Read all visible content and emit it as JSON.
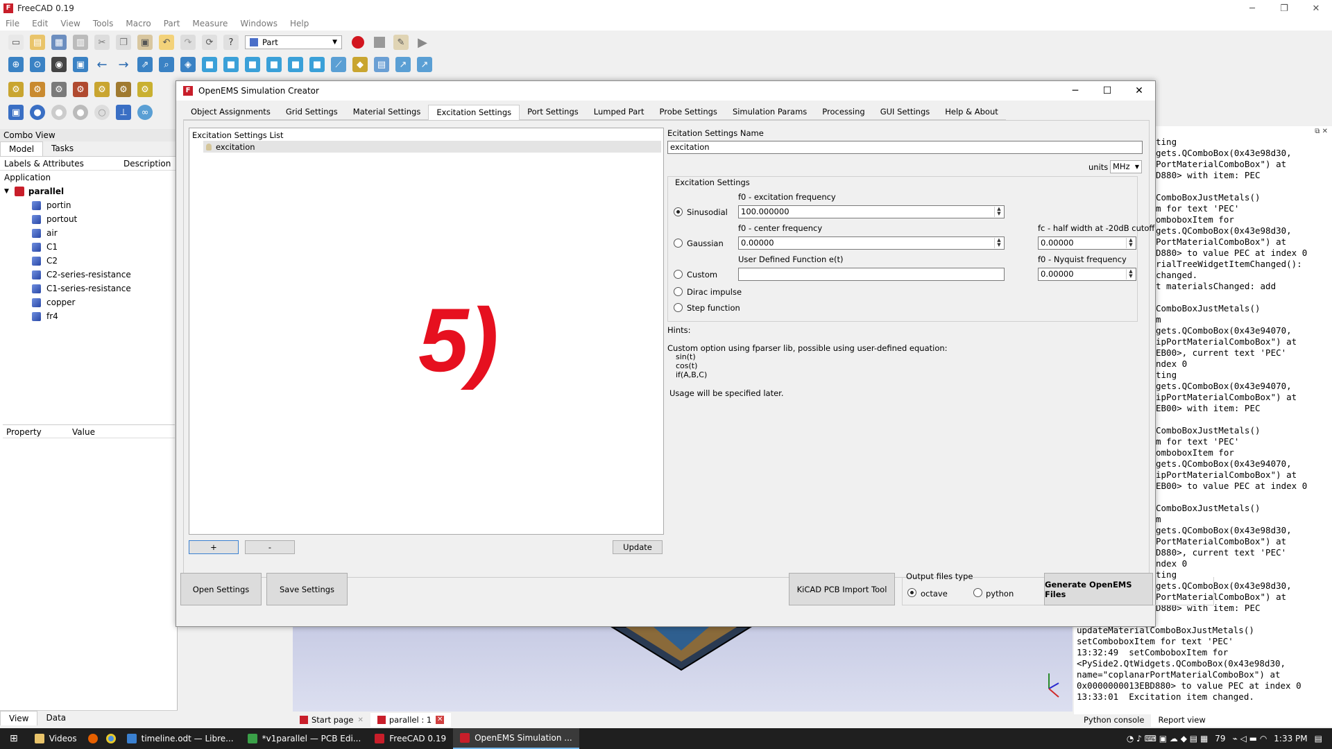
{
  "freecad": {
    "title": "FreeCAD 0.19",
    "menu": [
      "File",
      "Edit",
      "View",
      "Tools",
      "Macro",
      "Part",
      "Measure",
      "Windows",
      "Help"
    ],
    "workbench": "Part"
  },
  "combo_view": {
    "title": "Combo View",
    "tabs": [
      "Model",
      "Tasks"
    ],
    "tree_header": [
      "Labels & Attributes",
      "Description"
    ],
    "application_label": "Application",
    "root": "parallel",
    "items": [
      "portin",
      "portout",
      "air",
      "C1",
      "C2",
      "C2-series-resistance",
      "C1-series-resistance",
      "copper",
      "fr4"
    ],
    "property_header": [
      "Property",
      "Value"
    ],
    "bottom_tabs": [
      "View",
      "Data"
    ]
  },
  "dialog": {
    "title": "OpenEMS Simulation Creator",
    "tabs": [
      "Object Assignments",
      "Grid Settings",
      "Material Settings",
      "Excitation Settings",
      "Port Settings",
      "Lumped Part",
      "Probe Settings",
      "Simulation Params",
      "Processing",
      "GUI Settings",
      "Help & About"
    ],
    "active_tab": "Excitation Settings",
    "list_label": "Excitation Settings List",
    "list_items": [
      "excitation"
    ],
    "overlay_number": "5)",
    "add_label": "+",
    "remove_label": "-",
    "update_label": "Update",
    "name_label": "Ecitation Settings Name",
    "name_value": "excitation",
    "units_label": "units",
    "units_value": "MHz",
    "group_label": "Excitation Settings",
    "sinusoidal": {
      "label": "Sinusodial",
      "freq_label": "f0 - excitation frequency",
      "freq_value": "100.000000"
    },
    "gaussian": {
      "label": "Gaussian",
      "center_label": "f0 - center frequency",
      "center_value": "0.00000",
      "halfwidth_label": "fc - half width at -20dB cutoff",
      "halfwidth_value": "0.00000"
    },
    "custom": {
      "label": "Custom",
      "func_label": "User Defined Function e(t)",
      "func_value": "",
      "nyquist_label": "f0 - Nyquist frequency",
      "nyquist_value": "0.00000"
    },
    "dirac_label": "Dirac impulse",
    "step_label": "Step function",
    "hints_label": "Hints:",
    "hints_text": "Custom option using fparser lib, possible using user-defined equation:",
    "hints_examples": [
      "sin(t)",
      "cos(t)",
      "if(A,B,C)"
    ],
    "usage_text": "Usage will be specified later.",
    "open_settings": "Open Settings",
    "save_settings": "Save Settings",
    "kicad_import": "KiCAD PCB Import Tool",
    "output_type_label": "Output files type",
    "output_octave": "octave",
    "output_python": "python",
    "generate_label": "Generate OpenEMS Files"
  },
  "report": {
    "lines": [
      "ting",
      "gets.QComboBox(0x43e98d30,",
      "PortMaterialComboBox\") at",
      "D880> with item: PEC",
      "",
      "ComboBoxJustMetals()",
      "m for text 'PEC'",
      "omboboxItem for",
      "gets.QComboBox(0x43e98d30,",
      "PortMaterialComboBox\") at",
      "D880> to value PEC at index 0",
      "rialTreeWidgetItemChanged():",
      "changed.",
      "t materialsChanged: add",
      "",
      "ComboBoxJustMetals()",
      "m",
      "gets.QComboBox(0x43e94070,",
      "ipPortMaterialComboBox\") at",
      "EB00>, current text 'PEC'",
      "ndex 0",
      "ting",
      "gets.QComboBox(0x43e94070,",
      "ipPortMaterialComboBox\") at",
      "EB00> with item: PEC",
      "",
      "ComboBoxJustMetals()",
      "m for text 'PEC'",
      "omboboxItem for",
      "gets.QComboBox(0x43e94070,",
      "ipPortMaterialComboBox\") at",
      "EB00> to value PEC at index 0",
      "",
      "ComboBoxJustMetals()",
      "m",
      "gets.QComboBox(0x43e98d30,",
      "PortMaterialComboBox\") at",
      "D880>, current text 'PEC'",
      "ndex 0",
      "ting",
      "gets.QComboBox(0x43e98d30,",
      "PortMaterialComboBox\") at",
      "D880> with item: PEC"
    ],
    "lower_lines": [
      "updateMaterialComboBoxJustMetals()",
      "setComboboxItem for text 'PEC'",
      "13:32:49  setComboboxItem for",
      "<PySide2.QtWidgets.QComboBox(0x43e98d30,",
      "name=\"coplanarPortMaterialComboBox\") at",
      "0x0000000013EBD880> to value PEC at index 0",
      "13:33:01  Excitation item changed."
    ],
    "bottom_tabs": [
      "Python console",
      "Report view"
    ]
  },
  "doc_tabs": [
    "Start page",
    "parallel : 1"
  ],
  "taskbar": {
    "items": [
      "Videos",
      "timeline.odt — Libre...",
      "*v1parallel — PCB Edi...",
      "FreeCAD 0.19",
      "OpenEMS Simulation ..."
    ],
    "active": "OpenEMS Simulation ...",
    "tray_number": "79",
    "clock": "1:33 PM"
  },
  "colors": {
    "accent_red": "#e6101f",
    "taskbar": "#1f1f1f"
  }
}
